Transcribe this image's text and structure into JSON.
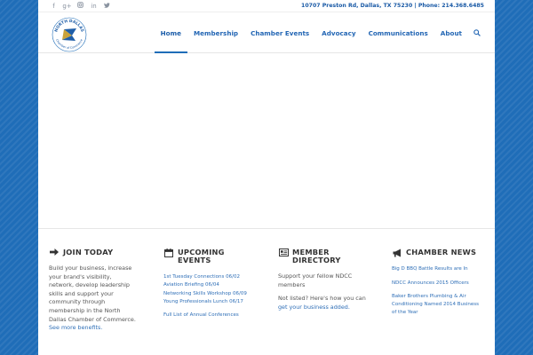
{
  "social_icons": [
    "facebook-icon",
    "google-plus-icon",
    "instagram-icon",
    "linkedin-icon",
    "twitter-icon"
  ],
  "contact_line": "10707 Preston Rd, Dallas, TX 75230 | Phone: 214.368.6485",
  "logo": {
    "top_text": "NORTH DALLAS",
    "bottom_text": "Chamber of Commerce"
  },
  "nav": {
    "items": [
      "Home",
      "Membership",
      "Chamber Events",
      "Advocacy",
      "Communications",
      "About"
    ],
    "active": "Home"
  },
  "colors": {
    "brand_blue": "#1f6db8",
    "link_blue": "#2f6fb7",
    "logo_gold": "#c9a23a"
  },
  "footer": {
    "join": {
      "title": "JOIN TODAY",
      "body": "Build your business, increase your brand's visibility, network, develop leadership skills and support your community through membership in the North Dallas Chamber of Commerce.",
      "link": "See more benefits."
    },
    "events": {
      "title_line1": "UPCOMING",
      "title_line2": "EVENTS",
      "items": [
        "1st Tuesday Connections 06/02",
        "Aviation Briefing 06/04",
        "Networking Skills Workshop 06/09",
        "Young Professionals Lunch 06/17"
      ],
      "more": "Full List of Annual Conferences"
    },
    "directory": {
      "title_line1": "MEMBER",
      "title_line2": "DIRECTORY",
      "body1": "Support your fellow NDCC members",
      "body2": "Not listed? Here's how you can",
      "link": "get your business added."
    },
    "news": {
      "title": "CHAMBER NEWS",
      "items": [
        "Big D BBQ Battle Results are In",
        "NDCC Announces 2015 Officers",
        "Baker Brothers Plumbing & Air Conditioning Named 2014 Business of the Year"
      ]
    }
  }
}
